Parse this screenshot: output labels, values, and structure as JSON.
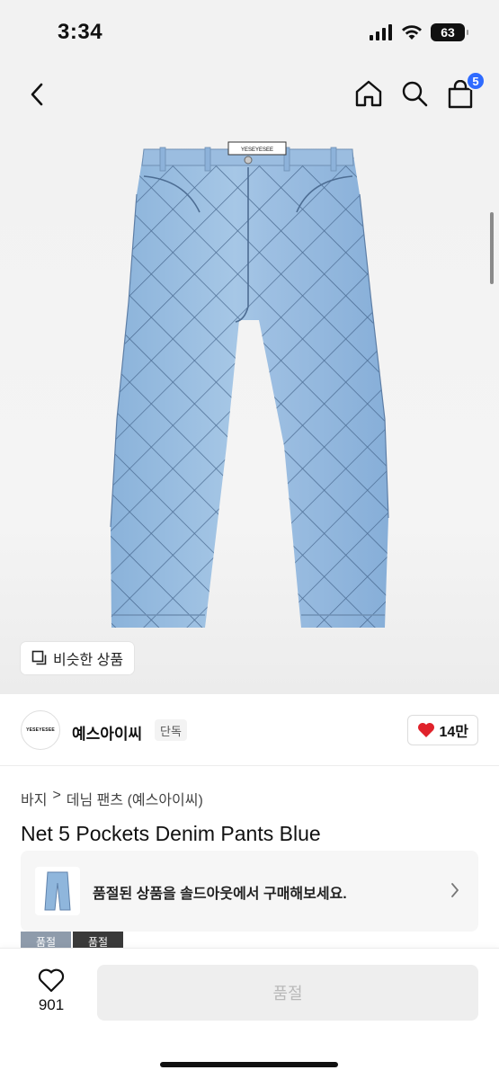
{
  "status_bar": {
    "time": "3:34",
    "battery": "63"
  },
  "nav": {
    "cart_count": "5"
  },
  "hero": {
    "similar_button_label": "비슷한 상품",
    "jeans_label": "YESEYESEE"
  },
  "brand": {
    "logo_text": "YESEYESEE",
    "name": "예스아이씨",
    "tag": "단독",
    "likes": "14만"
  },
  "breadcrumb": {
    "category": "바지",
    "separator": ">",
    "subcategory": "데님 팬츠 (예스아이씨)"
  },
  "product": {
    "title": "Net 5 Pockets Denim Pants Blue"
  },
  "soldout_banner": {
    "text": "품절된 상품을 솔드아웃에서 구매해보세요."
  },
  "thumbnails": [
    {
      "label": "품절"
    },
    {
      "label": "품절"
    }
  ],
  "bottom_bar": {
    "wish_count": "901",
    "buy_label": "품절"
  },
  "colors": {
    "badge": "#2f6bff",
    "heart": "#e0222b",
    "denim": "#8fb6dc"
  }
}
